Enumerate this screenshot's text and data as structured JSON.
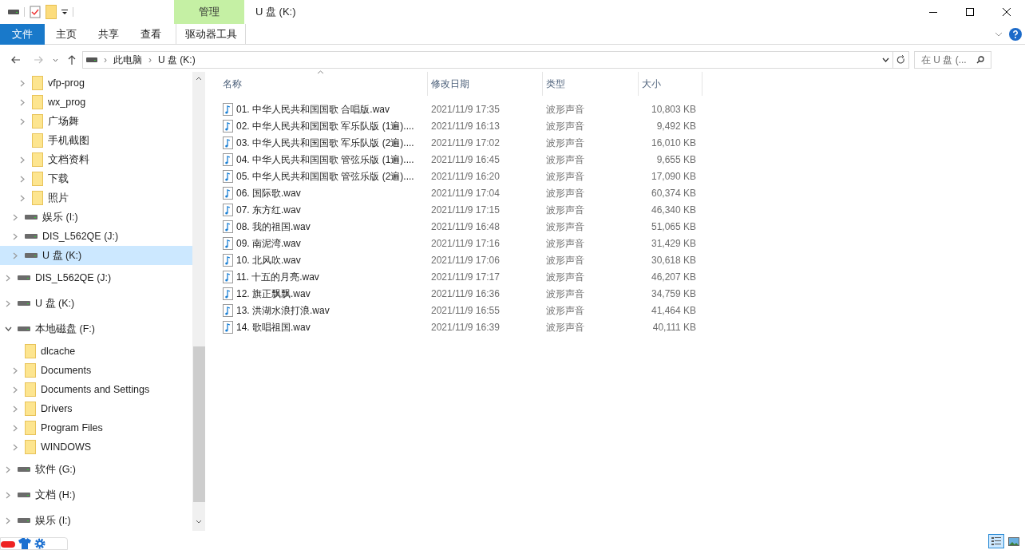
{
  "window": {
    "title": "U 盘 (K:)",
    "context_tab_group": "管理"
  },
  "ribbon_tabs": [
    {
      "label": "文件",
      "kind": "file",
      "selected": false
    },
    {
      "label": "主页",
      "kind": "tab",
      "selected": false
    },
    {
      "label": "共享",
      "kind": "tab",
      "selected": false
    },
    {
      "label": "查看",
      "kind": "tab",
      "selected": false
    },
    {
      "label": "驱动器工具",
      "kind": "context",
      "selected": false
    }
  ],
  "address": {
    "crumbs": [
      {
        "separator": "›",
        "label": "此电脑"
      },
      {
        "separator": "›",
        "label": "U 盘 (K:)"
      }
    ],
    "search_placeholder": "在 U 盘 (..."
  },
  "tree": [
    {
      "children": [
        {
          "children": [
            {
              "label": "vfp-prog",
              "kind": "folder",
              "expandable": true,
              "expanded": false,
              "selected": false
            },
            {
              "label": "wx_prog",
              "kind": "folder",
              "expandable": true,
              "expanded": false,
              "selected": false
            },
            {
              "label": "广场舞",
              "kind": "folder",
              "expandable": true,
              "expanded": false,
              "selected": false
            },
            {
              "label": "手机截图",
              "kind": "folder",
              "expandable": false,
              "selected": false
            },
            {
              "label": "文档资料",
              "kind": "folder",
              "expandable": true,
              "expanded": false,
              "selected": false
            },
            {
              "label": "下载",
              "kind": "folder",
              "expandable": true,
              "expanded": false,
              "selected": false
            },
            {
              "label": "照片",
              "kind": "folder",
              "expandable": true,
              "expanded": false,
              "selected": false
            }
          ]
        },
        {
          "label": "娱乐 (I:)",
          "kind": "drive",
          "expandable": true,
          "expanded": false,
          "selected": false
        },
        {
          "label": "DIS_L562QE (J:)",
          "kind": "drive",
          "expandable": true,
          "expanded": false,
          "selected": false
        },
        {
          "label": "U 盘 (K:)",
          "kind": "drive",
          "expandable": true,
          "expanded": false,
          "selected": true
        }
      ]
    },
    {
      "label": "DIS_L562QE (J:)",
      "kind": "drive",
      "expandable": true,
      "expanded": false,
      "selected": false
    },
    {
      "label": "U 盘 (K:)",
      "kind": "drive",
      "expandable": true,
      "expanded": false,
      "selected": false
    },
    {
      "label": "本地磁盘 (F:)",
      "kind": "drive",
      "expandable": true,
      "expanded": true,
      "selected": false,
      "children": [
        {
          "label": "dlcache",
          "kind": "folder",
          "expandable": false,
          "selected": false
        },
        {
          "label": "Documents",
          "kind": "folder",
          "expandable": true,
          "expanded": false,
          "selected": false
        },
        {
          "label": "Documents and Settings",
          "kind": "folder",
          "expandable": true,
          "expanded": false,
          "selected": false
        },
        {
          "label": "Drivers",
          "kind": "folder",
          "expandable": true,
          "expanded": false,
          "selected": false
        },
        {
          "label": "Program Files",
          "kind": "folder",
          "expandable": true,
          "expanded": false,
          "selected": false
        },
        {
          "label": "WINDOWS",
          "kind": "folder",
          "expandable": true,
          "expanded": false,
          "selected": false
        }
      ]
    },
    {
      "label": "软件 (G:)",
      "kind": "drive",
      "expandable": true,
      "expanded": false,
      "selected": false
    },
    {
      "label": "文档 (H:)",
      "kind": "drive",
      "expandable": true,
      "expanded": false,
      "selected": false
    },
    {
      "label": "娱乐 (I:)",
      "kind": "drive",
      "expandable": true,
      "expanded": false,
      "selected": false
    }
  ],
  "table": {
    "columns": [
      "名称",
      "修改日期",
      "类型",
      "大小"
    ],
    "rows": [
      [
        "01. 中华人民共和国国歌 合唱版.wav",
        "2021/11/9 17:35",
        "波形声音",
        "10,803 KB"
      ],
      [
        "02. 中华人民共和国国歌 军乐队版 (1遍)....",
        "2021/11/9 16:13",
        "波形声音",
        "9,492 KB"
      ],
      [
        "03. 中华人民共和国国歌 军乐队版 (2遍)....",
        "2021/11/9 17:02",
        "波形声音",
        "16,010 KB"
      ],
      [
        "04. 中华人民共和国国歌 管弦乐版 (1遍)....",
        "2021/11/9 16:45",
        "波形声音",
        "9,655 KB"
      ],
      [
        "05. 中华人民共和国国歌 管弦乐版 (2遍)....",
        "2021/11/9 16:20",
        "波形声音",
        "17,090 KB"
      ],
      [
        "06. 国际歌.wav",
        "2021/11/9 17:04",
        "波形声音",
        "60,374 KB"
      ],
      [
        "07. 东方红.wav",
        "2021/11/9 17:15",
        "波形声音",
        "46,340 KB"
      ],
      [
        "08. 我的祖国.wav",
        "2021/11/9 16:48",
        "波形声音",
        "51,065 KB"
      ],
      [
        "09. 南泥湾.wav",
        "2021/11/9 17:16",
        "波形声音",
        "31,429 KB"
      ],
      [
        "10. 北风吹.wav",
        "2021/11/9 17:06",
        "波形声音",
        "30,618 KB"
      ],
      [
        "11. 十五的月亮.wav",
        "2021/11/9 17:17",
        "波形声音",
        "46,207 KB"
      ],
      [
        "12. 旗正飘飘.wav",
        "2021/11/9 16:36",
        "波形声音",
        "34,759 KB"
      ],
      [
        "13. 洪湖水浪打浪.wav",
        "2021/11/9 16:55",
        "波形声音",
        "41,464 KB"
      ],
      [
        "14. 歌唱祖国.wav",
        "2021/11/9 16:39",
        "波形声音",
        "40,111 KB"
      ]
    ]
  },
  "view_buttons": [
    {
      "kind": "details",
      "selected": true
    },
    {
      "kind": "large_icons",
      "selected": false
    }
  ]
}
